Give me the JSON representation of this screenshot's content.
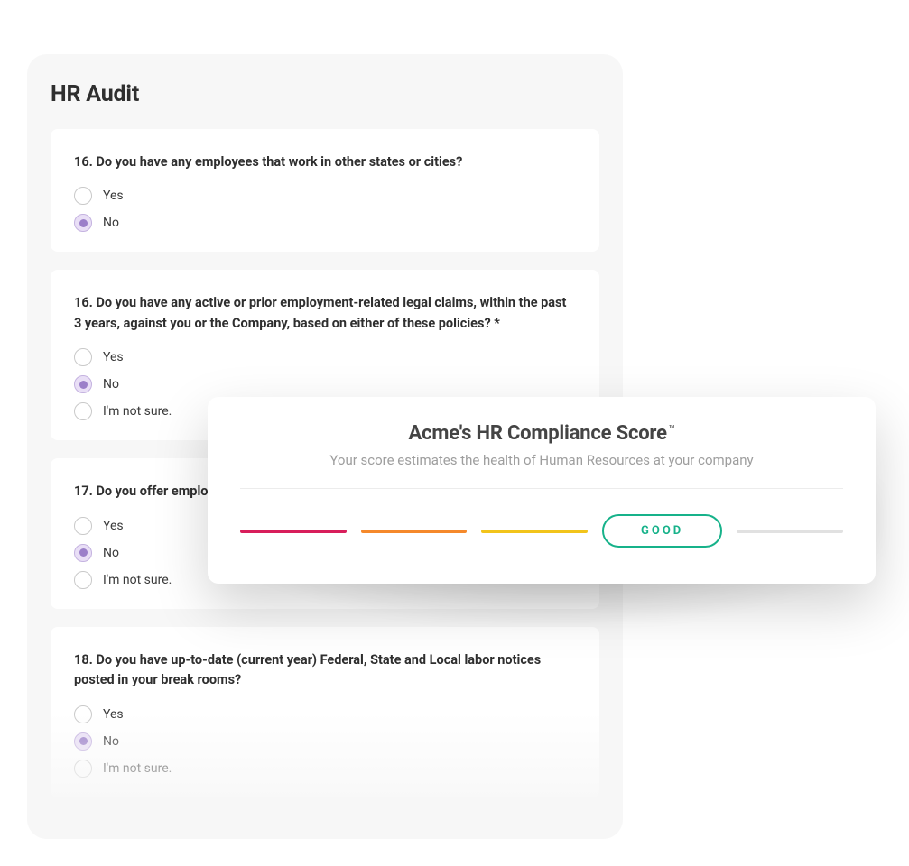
{
  "audit": {
    "title": "HR Audit",
    "questions": [
      {
        "number": "16.",
        "text": "Do you have any employees that work in other states or cities?",
        "options": [
          "Yes",
          "No"
        ],
        "selected": 1
      },
      {
        "number": "16.",
        "text": "Do you have any active or prior employment-related legal claims, within the past 3 years, against you or the Company, based on either of these policies? *",
        "options": [
          "Yes",
          "No",
          "I'm not sure."
        ],
        "selected": 1
      },
      {
        "number": "17.",
        "text": "Do you offer employe",
        "options": [
          "Yes",
          "No",
          "I'm not sure."
        ],
        "selected": 1
      },
      {
        "number": "18.",
        "text": "Do you have up-to-date (current year) Federal, State and Local labor notices posted in your break rooms?",
        "options": [
          "Yes",
          "No",
          "I'm not sure."
        ],
        "selected": 1
      }
    ]
  },
  "score": {
    "title_prefix": "Acme's HR Compliance Score",
    "title_tm": "™",
    "subtitle": "Your score estimates the health of Human Resources at your company",
    "good_label": "GOOD"
  }
}
